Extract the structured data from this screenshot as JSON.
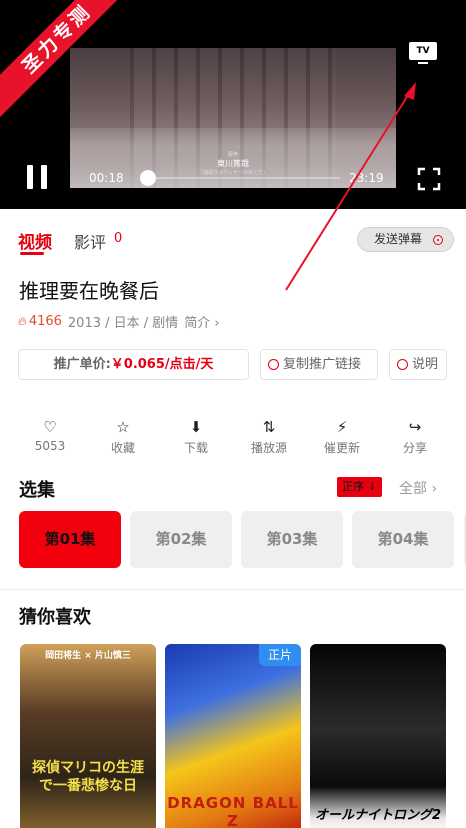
{
  "player": {
    "ribbon_text": "圣力专测",
    "tv_label": "TV",
    "current_time": "00:18",
    "total_time": "23:19",
    "progress": 0.04,
    "subtitle_small": "原作",
    "subtitle_main": "東川篤哉",
    "subtitle_line": "「謎解きはディナーのあとで」"
  },
  "tabs": {
    "video_label": "视频",
    "review_label": "影评",
    "review_count": "0",
    "danmaku_label": "发送弹幕"
  },
  "info": {
    "title": "推理要在晚餐后",
    "hot_count": "4166",
    "meta_text": "2013 / 日本 / 剧情",
    "intro_link": "简介 ›"
  },
  "promo": {
    "label": "推广单价:",
    "price": "￥0.065",
    "unit": "/点击/天",
    "copy_link_label": "复制推广链接",
    "explain_label": "说明"
  },
  "actions": [
    {
      "icon": "heart-icon",
      "glyph": "♡",
      "label": "5053"
    },
    {
      "icon": "star-icon",
      "glyph": "☆",
      "label": "收藏"
    },
    {
      "icon": "download-icon",
      "glyph": "⬇",
      "label": "下载"
    },
    {
      "icon": "switch-source-icon",
      "glyph": "⇅",
      "label": "播放源"
    },
    {
      "icon": "lightning-icon",
      "glyph": "⚡",
      "label": "催更新"
    },
    {
      "icon": "share-icon",
      "glyph": "↪",
      "label": "分享"
    }
  ],
  "episodes": {
    "section_title": "选集",
    "order_label": "正序 ⇃",
    "all_label": "全部 ›",
    "items": [
      "第01集",
      "第02集",
      "第03集",
      "第04集"
    ]
  },
  "recommend": {
    "section_title": "猜你喜欢",
    "posters": [
      {
        "top_text": "岡田将生 × 片山慎三",
        "main_text": "探偵マリコの生涯で一番悲惨な日"
      },
      {
        "badge": "正片",
        "main_text": "DRAGON BALL Z"
      },
      {
        "main_text": "オールナイトロング2"
      }
    ]
  },
  "colors": {
    "accent": "#e60012",
    "ribbon": "#e8132a",
    "badge_blue": "#2f8ef0"
  }
}
